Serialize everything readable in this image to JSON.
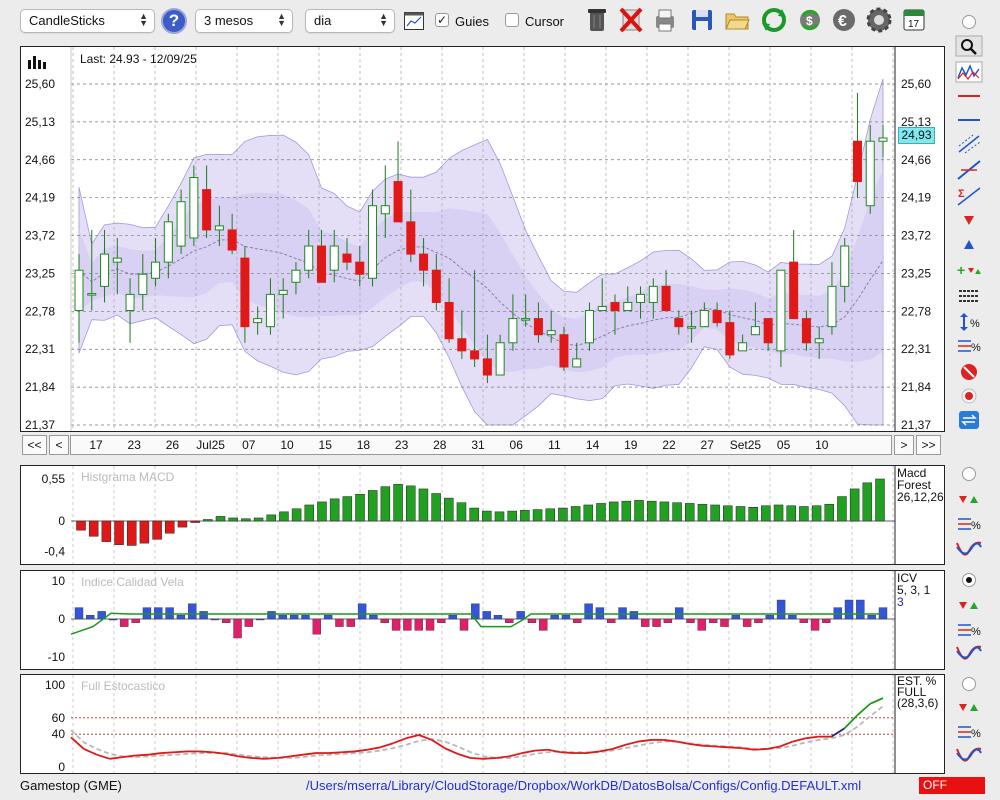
{
  "toolbar": {
    "chart_type": "CandleSticks",
    "period": "3 mesos",
    "interval": "dia",
    "guides_label": "Guies",
    "guides_checked": true,
    "cursor_label": "Cursor",
    "cursor_checked": false,
    "help_label": "?",
    "calendar_day": "17"
  },
  "main_chart": {
    "last_label": "Last: 24.93 - 12/09/25",
    "current_price": "24,93",
    "y_ticks": [
      "25,60",
      "25,13",
      "24,66",
      "24,19",
      "23,72",
      "23,25",
      "22,78",
      "22,31",
      "21,84",
      "21,37"
    ],
    "x_ticks": [
      "17",
      "23",
      "26",
      "Jul25",
      "07",
      "10",
      "15",
      "18",
      "23",
      "28",
      "31",
      "06",
      "11",
      "14",
      "19",
      "22",
      "27",
      "Set25",
      "05",
      "10"
    ],
    "nav": {
      "first": "<<",
      "prev": "<",
      "next": ">",
      "last": ">>"
    }
  },
  "macd_panel": {
    "title": "Histgrama MACD",
    "y_ticks": [
      "0,55",
      "0",
      "-0,4"
    ],
    "legend_name": "Macd Forest",
    "legend_params": "26,12,26"
  },
  "icv_panel": {
    "title": "Indice Calidad Vela",
    "y_ticks": [
      "10",
      "0",
      "-10"
    ],
    "legend_name": "ICV",
    "legend_params": "5, 3, 1",
    "legend_value": "3"
  },
  "stoch_panel": {
    "title": "Full Estocastico",
    "y_ticks": [
      "100",
      "60",
      "40",
      "0"
    ],
    "legend_name": "EST. % FULL",
    "legend_params": "(28,3,6)"
  },
  "status_bar": {
    "instrument": "Gamestop (GME)",
    "config_path": "/Users/mserra/Library/CloudStorage/Dropbox/WorkDB/DatosBolsa/Configs/Config.DEFAULT.xml",
    "status": "OFF"
  },
  "colors": {
    "up_candle": "#22a022",
    "down_candle": "#e01818",
    "band_fill": "#e2dcf7",
    "macd_positive": "#22a022",
    "macd_negative": "#e01818",
    "icv_positive": "#3355dd",
    "icv_negative": "#e0206a",
    "stoch_line": "#e01818",
    "status_off": "#e81010"
  },
  "chart_data": [
    {
      "type": "candlestick",
      "title": "Last: 24.93 - 12/09/25",
      "ylim": [
        21.37,
        25.6
      ],
      "x_tick_labels": [
        "17",
        "23",
        "26",
        "Jul25",
        "07",
        "10",
        "15",
        "18",
        "23",
        "28",
        "31",
        "06",
        "11",
        "14",
        "19",
        "22",
        "27",
        "Set25",
        "05",
        "10"
      ],
      "candles": [
        {
          "o": 22.79,
          "h": 23.49,
          "l": 22.39,
          "c": 23.29
        },
        {
          "o": 22.99,
          "h": 23.79,
          "l": 22.79,
          "c": 23.0
        },
        {
          "o": 23.09,
          "h": 23.79,
          "l": 22.89,
          "c": 23.49
        },
        {
          "o": 23.39,
          "h": 23.69,
          "l": 22.99,
          "c": 23.44
        },
        {
          "o": 22.79,
          "h": 23.19,
          "l": 22.39,
          "c": 22.99
        },
        {
          "o": 22.99,
          "h": 23.49,
          "l": 22.79,
          "c": 23.24
        },
        {
          "o": 23.19,
          "h": 23.69,
          "l": 23.09,
          "c": 23.39
        },
        {
          "o": 23.39,
          "h": 23.99,
          "l": 23.19,
          "c": 23.89
        },
        {
          "o": 23.59,
          "h": 24.29,
          "l": 23.49,
          "c": 24.14
        },
        {
          "o": 23.69,
          "h": 24.59,
          "l": 23.59,
          "c": 24.44
        },
        {
          "o": 24.29,
          "h": 24.59,
          "l": 23.69,
          "c": 23.79
        },
        {
          "o": 23.79,
          "h": 24.09,
          "l": 23.59,
          "c": 23.84
        },
        {
          "o": 23.79,
          "h": 23.99,
          "l": 23.49,
          "c": 23.54
        },
        {
          "o": 23.44,
          "h": 23.59,
          "l": 22.39,
          "c": 22.59
        },
        {
          "o": 22.64,
          "h": 22.84,
          "l": 22.49,
          "c": 22.69
        },
        {
          "o": 22.59,
          "h": 23.19,
          "l": 22.49,
          "c": 22.99
        },
        {
          "o": 22.99,
          "h": 23.19,
          "l": 22.69,
          "c": 23.04
        },
        {
          "o": 23.14,
          "h": 23.39,
          "l": 22.99,
          "c": 23.29
        },
        {
          "o": 23.29,
          "h": 23.79,
          "l": 23.19,
          "c": 23.59
        },
        {
          "o": 23.59,
          "h": 23.79,
          "l": 23.19,
          "c": 23.14
        },
        {
          "o": 23.29,
          "h": 23.79,
          "l": 23.14,
          "c": 23.59
        },
        {
          "o": 23.49,
          "h": 23.69,
          "l": 23.29,
          "c": 23.39
        },
        {
          "o": 23.39,
          "h": 23.59,
          "l": 23.09,
          "c": 23.24
        },
        {
          "o": 23.19,
          "h": 24.29,
          "l": 23.09,
          "c": 24.09
        },
        {
          "o": 23.99,
          "h": 24.59,
          "l": 23.69,
          "c": 24.09
        },
        {
          "o": 24.39,
          "h": 24.89,
          "l": 24.19,
          "c": 23.89
        },
        {
          "o": 23.89,
          "h": 24.29,
          "l": 23.39,
          "c": 23.49
        },
        {
          "o": 23.49,
          "h": 23.69,
          "l": 23.09,
          "c": 23.29
        },
        {
          "o": 23.29,
          "h": 23.49,
          "l": 22.79,
          "c": 22.89
        },
        {
          "o": 22.89,
          "h": 23.19,
          "l": 22.39,
          "c": 22.44
        },
        {
          "o": 22.44,
          "h": 22.79,
          "l": 22.19,
          "c": 22.29
        },
        {
          "o": 22.29,
          "h": 23.29,
          "l": 22.09,
          "c": 22.19
        },
        {
          "o": 22.19,
          "h": 22.49,
          "l": 21.89,
          "c": 21.99
        },
        {
          "o": 21.99,
          "h": 22.49,
          "l": 21.99,
          "c": 22.39
        },
        {
          "o": 22.39,
          "h": 22.99,
          "l": 22.29,
          "c": 22.69
        },
        {
          "o": 22.69,
          "h": 22.99,
          "l": 22.59,
          "c": 22.69
        },
        {
          "o": 22.69,
          "h": 22.89,
          "l": 22.39,
          "c": 22.49
        },
        {
          "o": 22.49,
          "h": 22.79,
          "l": 22.39,
          "c": 22.54
        },
        {
          "o": 22.49,
          "h": 22.59,
          "l": 22.04,
          "c": 22.09
        },
        {
          "o": 22.09,
          "h": 22.39,
          "l": 22.09,
          "c": 22.19
        },
        {
          "o": 22.39,
          "h": 22.89,
          "l": 22.29,
          "c": 22.79
        },
        {
          "o": 22.79,
          "h": 23.19,
          "l": 22.79,
          "c": 22.84
        },
        {
          "o": 22.89,
          "h": 22.99,
          "l": 22.49,
          "c": 22.79
        },
        {
          "o": 22.79,
          "h": 23.09,
          "l": 22.79,
          "c": 22.89
        },
        {
          "o": 22.89,
          "h": 23.09,
          "l": 22.69,
          "c": 22.99
        },
        {
          "o": 22.89,
          "h": 23.19,
          "l": 22.69,
          "c": 23.09
        },
        {
          "o": 23.09,
          "h": 23.29,
          "l": 22.79,
          "c": 22.79
        },
        {
          "o": 22.69,
          "h": 22.79,
          "l": 22.49,
          "c": 22.59
        },
        {
          "o": 22.59,
          "h": 22.79,
          "l": 22.39,
          "c": 22.59
        },
        {
          "o": 22.59,
          "h": 22.89,
          "l": 22.59,
          "c": 22.79
        },
        {
          "o": 22.79,
          "h": 22.89,
          "l": 22.59,
          "c": 22.64
        },
        {
          "o": 22.64,
          "h": 22.79,
          "l": 22.19,
          "c": 22.24
        },
        {
          "o": 22.29,
          "h": 22.49,
          "l": 22.29,
          "c": 22.39
        },
        {
          "o": 22.49,
          "h": 22.89,
          "l": 22.49,
          "c": 22.59
        },
        {
          "o": 22.69,
          "h": 22.69,
          "l": 22.29,
          "c": 22.39
        },
        {
          "o": 22.29,
          "h": 23.29,
          "l": 22.09,
          "c": 23.29
        },
        {
          "o": 23.39,
          "h": 23.79,
          "l": 22.69,
          "c": 22.69
        },
        {
          "o": 22.69,
          "h": 22.79,
          "l": 22.29,
          "c": 22.39
        },
        {
          "o": 22.39,
          "h": 22.59,
          "l": 22.19,
          "c": 22.44
        },
        {
          "o": 22.59,
          "h": 23.39,
          "l": 22.49,
          "c": 23.09
        },
        {
          "o": 23.09,
          "h": 23.69,
          "l": 22.89,
          "c": 23.59
        },
        {
          "o": 24.89,
          "h": 25.49,
          "l": 24.19,
          "c": 24.39
        },
        {
          "o": 24.09,
          "h": 25.09,
          "l": 23.99,
          "c": 24.89
        },
        {
          "o": 24.89,
          "h": 25.09,
          "l": 24.69,
          "c": 24.93
        }
      ]
    },
    {
      "type": "bar",
      "title": "Histgrama MACD",
      "ylim": [
        -0.4,
        0.55
      ],
      "values": [
        -0.12,
        -0.2,
        -0.27,
        -0.31,
        -0.32,
        -0.29,
        -0.24,
        -0.16,
        -0.08,
        -0.02,
        0.02,
        0.06,
        0.04,
        0.03,
        0.04,
        0.08,
        0.12,
        0.16,
        0.21,
        0.25,
        0.29,
        0.32,
        0.35,
        0.4,
        0.45,
        0.48,
        0.46,
        0.42,
        0.36,
        0.3,
        0.24,
        0.17,
        0.13,
        0.12,
        0.13,
        0.14,
        0.15,
        0.16,
        0.17,
        0.19,
        0.21,
        0.23,
        0.25,
        0.26,
        0.27,
        0.26,
        0.25,
        0.24,
        0.23,
        0.22,
        0.21,
        0.2,
        0.19,
        0.18,
        0.2,
        0.21,
        0.2,
        0.19,
        0.2,
        0.22,
        0.32,
        0.42,
        0.5,
        0.55
      ]
    },
    {
      "type": "bar",
      "title": "Indice Calidad Vela",
      "ylim": [
        -10,
        10
      ],
      "values": [
        3,
        1,
        2,
        0,
        -2,
        -1,
        3,
        3,
        3,
        1,
        4,
        2,
        0,
        -1,
        -5,
        -2,
        0,
        2,
        1,
        1,
        1,
        -4,
        1,
        -2,
        -2,
        4,
        1,
        -1,
        -3,
        -3,
        -3,
        -3,
        -1,
        1,
        -3,
        4,
        2,
        1,
        -1,
        2,
        -1,
        -3,
        1,
        1,
        -1,
        4,
        3,
        -1,
        3,
        2,
        -2,
        -2,
        -1,
        3,
        -1,
        -3,
        -1,
        -2,
        1,
        -2,
        -1,
        1,
        5,
        1,
        -1,
        -3,
        -1,
        3,
        5,
        5,
        1,
        3
      ]
    },
    {
      "type": "line",
      "title": "Full Estocastico",
      "ylim": [
        0,
        100
      ],
      "x": [
        0,
        1,
        2,
        3,
        4,
        5,
        6,
        7,
        8,
        9,
        10,
        11,
        12,
        13,
        14,
        15,
        16,
        17,
        18,
        19,
        20,
        21,
        22,
        23,
        24,
        25,
        26,
        27,
        28,
        29,
        30,
        31,
        32,
        33,
        34,
        35,
        36,
        37,
        38,
        39,
        40,
        41,
        42,
        43,
        44,
        45,
        46,
        47,
        48,
        49,
        50,
        51,
        52,
        53,
        54,
        55,
        56,
        57,
        58,
        59,
        60,
        61,
        62,
        63
      ],
      "series": [
        {
          "values": [
            36,
            22,
            15,
            10,
            12,
            14,
            15,
            17,
            18,
            19,
            19,
            18,
            16,
            13,
            11,
            10,
            11,
            13,
            15,
            17,
            17,
            18,
            19,
            21,
            24,
            29,
            35,
            39,
            33,
            23,
            16,
            11,
            10,
            11,
            13,
            17,
            20,
            21,
            18,
            17,
            17,
            19,
            22,
            27,
            31,
            33,
            33,
            31,
            28,
            26,
            25,
            24,
            23,
            21,
            22,
            25,
            31,
            35,
            37,
            37,
            47,
            63,
            77,
            84
          ]
        },
        {
          "values": [
            45,
            30,
            22,
            16,
            13,
            12,
            13,
            14,
            15,
            16,
            17,
            17,
            17,
            15,
            13,
            12,
            11,
            11,
            12,
            14,
            15,
            16,
            17,
            18,
            20,
            23,
            27,
            32,
            34,
            31,
            25,
            18,
            13,
            11,
            11,
            13,
            16,
            18,
            19,
            18,
            18,
            18,
            20,
            23,
            26,
            29,
            31,
            31,
            29,
            27,
            26,
            25,
            24,
            22,
            22,
            23,
            26,
            30,
            33,
            35,
            39,
            49,
            62,
            74
          ]
        }
      ]
    }
  ]
}
